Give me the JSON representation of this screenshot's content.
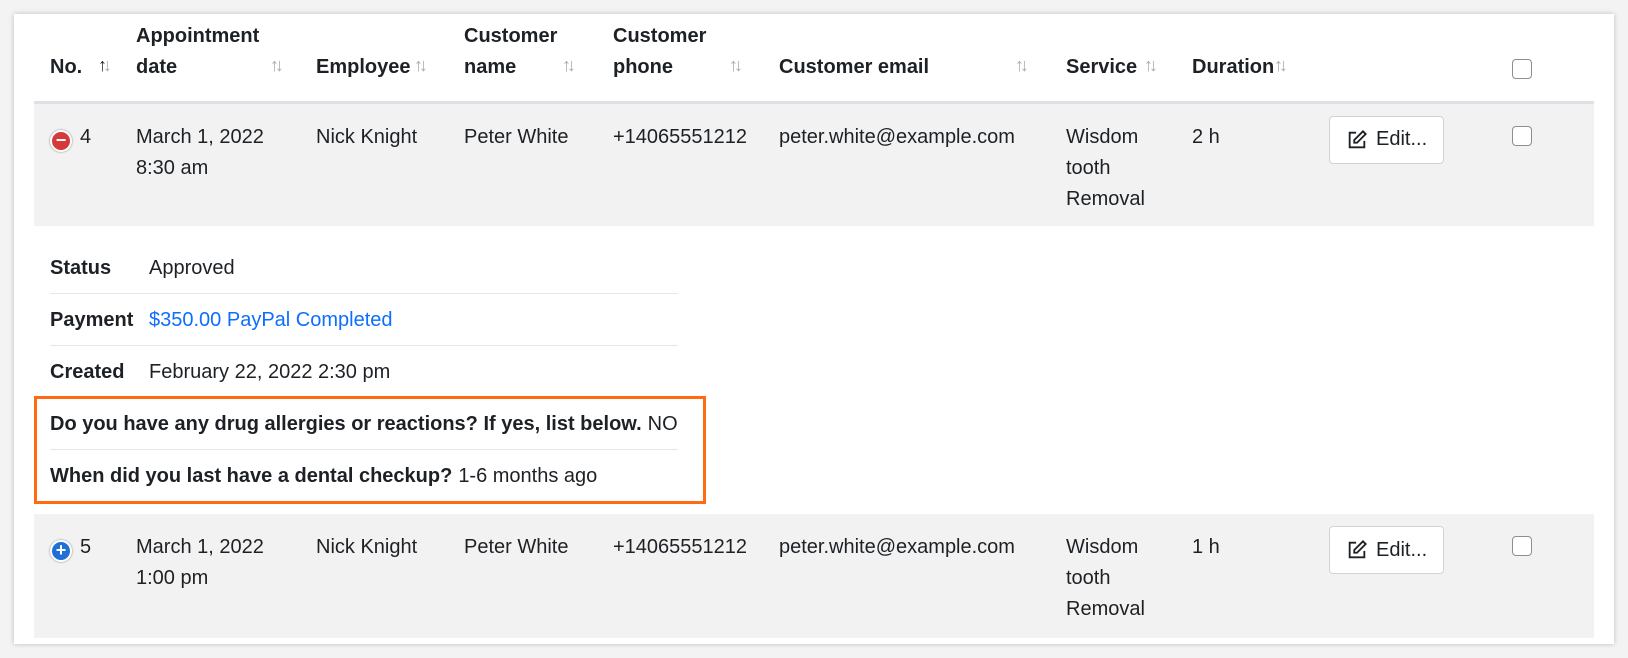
{
  "table": {
    "columns": [
      {
        "key": "no",
        "label": "No."
      },
      {
        "key": "date",
        "label": "Appointment date"
      },
      {
        "key": "employee",
        "label": "Employee"
      },
      {
        "key": "customer_name",
        "label": "Customer name"
      },
      {
        "key": "customer_phone",
        "label": "Customer phone"
      },
      {
        "key": "customer_email",
        "label": "Customer email"
      },
      {
        "key": "service",
        "label": "Service"
      },
      {
        "key": "duration",
        "label": "Duration"
      }
    ],
    "edit_label": "Edit...",
    "rows": [
      {
        "no": "4",
        "date_line1": "March 1, 2022",
        "date_line2": "8:30 am",
        "employee": "Nick Knight",
        "customer_name": "Peter White",
        "customer_phone": "+14065551212",
        "customer_email": "peter.white@example.com",
        "service": "Wisdom tooth Removal",
        "duration": "2 h",
        "expanded": true
      },
      {
        "no": "5",
        "date_line1": "March 1, 2022",
        "date_line2": "1:00 pm",
        "employee": "Nick Knight",
        "customer_name": "Peter White",
        "customer_phone": "+14065551212",
        "customer_email": "peter.white@example.com",
        "service": "Wisdom tooth Removal",
        "duration": "1 h",
        "expanded": false
      }
    ]
  },
  "detail": {
    "status_label": "Status",
    "status_value": "Approved",
    "payment_label": "Payment",
    "payment_value": "$350.00 PayPal Completed",
    "created_label": "Created",
    "created_value": "February 22, 2022 2:30 pm",
    "questions": [
      {
        "question": "Do you have any drug allergies or reactions? If yes, list below.",
        "answer": "NO"
      },
      {
        "question": "When did you last have a dental checkup?",
        "answer": "1-6 months ago"
      }
    ]
  },
  "colors": {
    "highlight_border": "#ff6a13",
    "link": "#0d6efd",
    "row_bg": "#f2f2f2",
    "collapse_icon": "#d63939",
    "expand_icon": "#1f6fd6"
  },
  "icons": {
    "collapse": "minus-circle-icon",
    "expand": "plus-circle-icon",
    "edit": "pencil-square-icon",
    "sort": "sort-arrows-icon"
  }
}
